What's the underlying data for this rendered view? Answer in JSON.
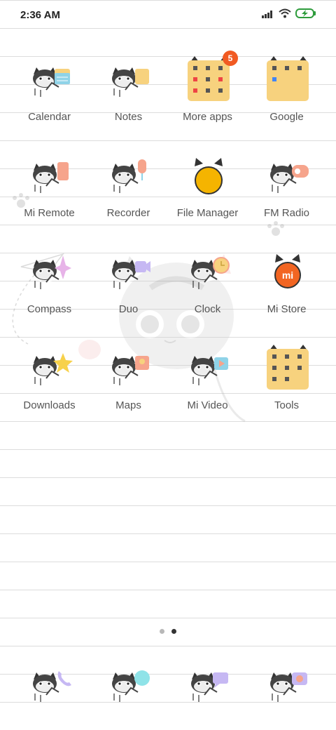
{
  "status": {
    "time": "2:36 AM"
  },
  "apps": [
    {
      "label": "Calendar",
      "icon": "calendar-icon"
    },
    {
      "label": "Notes",
      "icon": "notes-icon"
    },
    {
      "label": "More apps",
      "icon": "folder-icon",
      "badge": "5"
    },
    {
      "label": "Google",
      "icon": "folder-icon"
    },
    {
      "label": "Mi Remote",
      "icon": "remote-icon"
    },
    {
      "label": "Recorder",
      "icon": "microphone-icon"
    },
    {
      "label": "File Manager",
      "icon": "file-manager-icon"
    },
    {
      "label": "FM Radio",
      "icon": "radio-icon"
    },
    {
      "label": "Compass",
      "icon": "compass-icon"
    },
    {
      "label": "Duo",
      "icon": "video-camera-icon"
    },
    {
      "label": "Clock",
      "icon": "clock-icon"
    },
    {
      "label": "Mi Store",
      "icon": "mi-store-icon"
    },
    {
      "label": "Downloads",
      "icon": "star-icon"
    },
    {
      "label": "Maps",
      "icon": "map-icon"
    },
    {
      "label": "Mi Video",
      "icon": "play-icon"
    },
    {
      "label": "Tools",
      "icon": "folder-icon"
    }
  ],
  "dock": [
    {
      "icon": "phone-icon"
    },
    {
      "icon": "browser-icon"
    },
    {
      "icon": "messages-icon"
    },
    {
      "icon": "camera-icon"
    }
  ],
  "pager": {
    "pages": 2,
    "current": 2
  },
  "colors": {
    "folder_bg": "#f7d27e",
    "badge": "#f15a22",
    "file_manager": "#f5b400",
    "mi_orange": "#f26522"
  }
}
